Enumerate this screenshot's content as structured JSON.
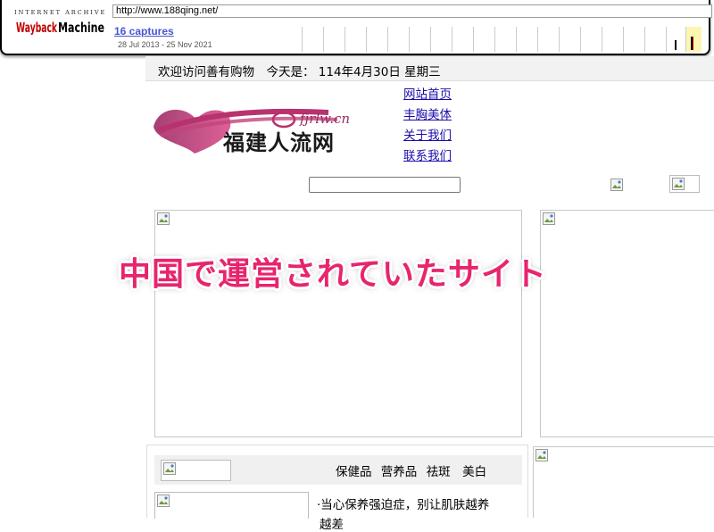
{
  "wayback": {
    "logo_top": "INTERNET ARCHIVE",
    "logo": "WaybackMachine",
    "url": "http://www.188qing.net/",
    "captures": "16 captures",
    "date_range": "28 Jul 2013 - 25 Nov 2021"
  },
  "site": {
    "welcome": "欢迎访问善有购物　今天是： 114年4月30日 星期三",
    "logo_text": "福建人流网",
    "logo_sub": "fjrlw.cn",
    "nav": [
      "网站首页",
      "丰胸美体",
      "关于我们",
      "联系我们"
    ],
    "categories": "保健品 营养品 祛斑　美白",
    "article_title": "·当心保养强迫症，别让肌肤越养",
    "article_title_cont": "越差"
  },
  "overlay": {
    "caption": "中国で運営されていたサイト"
  },
  "colors": {
    "accent": "#e8246e",
    "link": "#1a0dab",
    "wayback_captures": "#4757d1"
  }
}
